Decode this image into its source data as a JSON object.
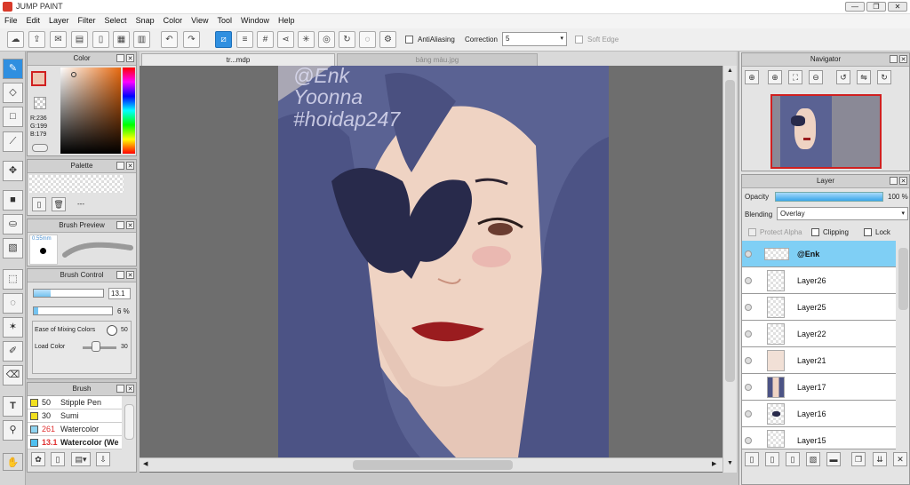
{
  "window": {
    "title": "JUMP PAINT",
    "min": "—",
    "max": "❐",
    "close": "✕"
  },
  "menu": [
    "File",
    "Edit",
    "Layer",
    "Filter",
    "Select",
    "Snap",
    "Color",
    "View",
    "Tool",
    "Window",
    "Help"
  ],
  "toolbar": {
    "antialiasing_label": "AntiAliasing",
    "correction_label": "Correction",
    "correction_value": "5",
    "soft_edge_label": "Soft Edge"
  },
  "tabs": [
    {
      "label": "tr...mdp"
    },
    {
      "label": "bảng màu.jpg"
    }
  ],
  "panels": {
    "color": {
      "title": "Color",
      "r": "R:236",
      "g": "G:199",
      "b": "B:179"
    },
    "palette": {
      "title": "Palette",
      "extra": "---"
    },
    "brush_preview": {
      "title": "Brush Preview",
      "size": "0.55mm"
    },
    "brush_control": {
      "title": "Brush Control",
      "size_value": "13.1",
      "opacity_value": "6 %",
      "mixing_label": "Ease of Mixing Colors",
      "mixing_value": "50",
      "load_label": "Load Color",
      "load_value": "30"
    },
    "brush": {
      "title": "Brush",
      "items": [
        {
          "size": "50",
          "name": "Stipple Pen",
          "color": "#f2e020"
        },
        {
          "size": "30",
          "name": "Sumi",
          "color": "#f2e020"
        },
        {
          "size": "261",
          "name": "Watercolor",
          "color": "#8fd3f0"
        },
        {
          "size": "13.1",
          "name": "Watercolor (We",
          "color": "#4fc0f0"
        }
      ]
    },
    "navigator": {
      "title": "Navigator"
    },
    "layer": {
      "title": "Layer",
      "opacity_label": "Opacity",
      "opacity_value": "100 %",
      "blending_label": "Blending",
      "blending_value": "Overlay",
      "protect_alpha": "Protect Alpha",
      "clipping": "Clipping",
      "lock": "Lock",
      "layers": [
        "@Enk",
        "Layer26",
        "Layer25",
        "Layer22",
        "Layer21",
        "Layer17",
        "Layer16",
        "Layer15"
      ]
    }
  },
  "watermark": {
    "line1": "@Enk",
    "line2": "Yoonna",
    "line3": "#hoidap247"
  }
}
